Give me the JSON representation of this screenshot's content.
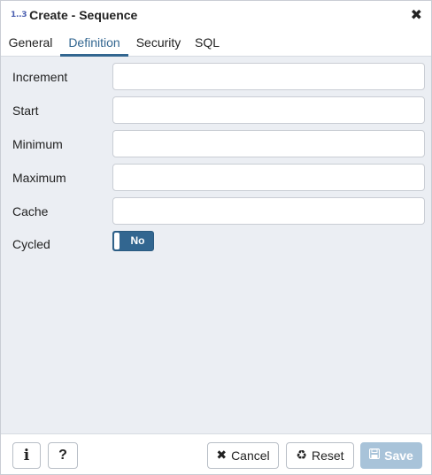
{
  "dialog": {
    "icon_text": "1..3",
    "title": "Create - Sequence",
    "close_symbol": "✖"
  },
  "tabs": [
    {
      "label": "General",
      "active": false
    },
    {
      "label": "Definition",
      "active": true
    },
    {
      "label": "Security",
      "active": false
    },
    {
      "label": "SQL",
      "active": false
    }
  ],
  "fields": {
    "increment": {
      "label": "Increment",
      "value": ""
    },
    "start": {
      "label": "Start",
      "value": ""
    },
    "minimum": {
      "label": "Minimum",
      "value": ""
    },
    "maximum": {
      "label": "Maximum",
      "value": ""
    },
    "cache": {
      "label": "Cache",
      "value": ""
    },
    "cycled": {
      "label": "Cycled",
      "toggle_text": "No",
      "state": false
    }
  },
  "footer": {
    "info_label": "i",
    "help_label": "?",
    "cancel_label": "Cancel",
    "reset_label": "Reset",
    "save_label": "Save",
    "cancel_icon": "✖",
    "reset_icon": "♻",
    "save_icon": "💾"
  },
  "colors": {
    "accent": "#326690",
    "save_disabled": "#a8c3d9",
    "body_bg": "#ebeef3"
  }
}
